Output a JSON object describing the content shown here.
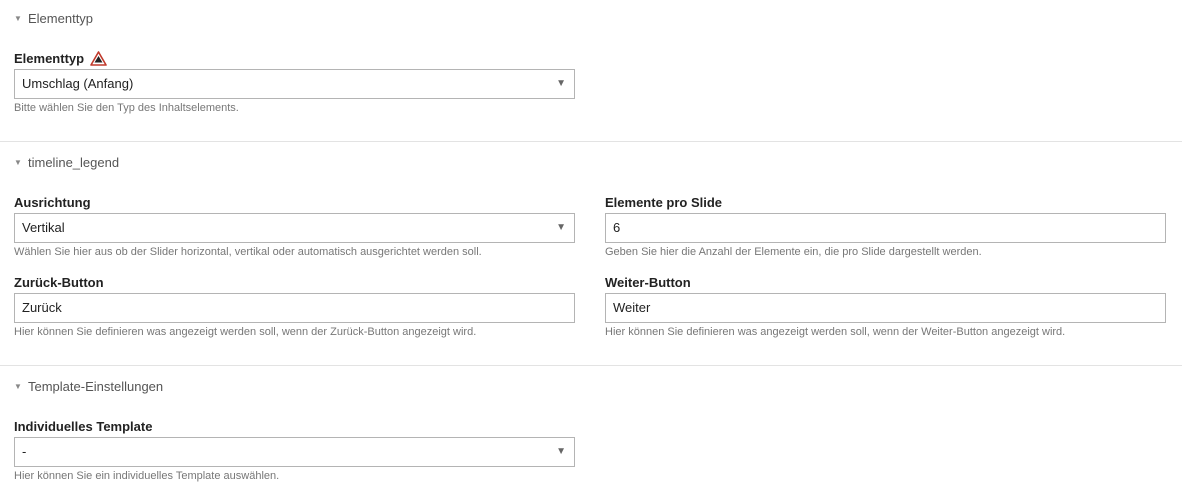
{
  "sections": {
    "elementtyp": {
      "legend": "Elementtyp"
    },
    "timeline": {
      "legend": "timeline_legend"
    },
    "template": {
      "legend": "Template-Einstellungen"
    }
  },
  "fields": {
    "elementtyp": {
      "label": "Elementtyp",
      "value": "Umschlag (Anfang)",
      "help": "Bitte wählen Sie den Typ des Inhaltselements.",
      "warning_icon": "warning-triangle-icon"
    },
    "ausrichtung": {
      "label": "Ausrichtung",
      "value": "Vertikal",
      "help": "Wählen Sie hier aus ob der Slider horizontal, vertikal oder automatisch ausgerichtet werden soll."
    },
    "elemente_pro_slide": {
      "label": "Elemente pro Slide",
      "value": "6",
      "help": "Geben Sie hier die Anzahl der Elemente ein, die pro Slide dargestellt werden."
    },
    "zurueck_button": {
      "label": "Zurück-Button",
      "value": "Zurück",
      "help": "Hier können Sie definieren was angezeigt werden soll, wenn der Zurück-Button angezeigt wird."
    },
    "weiter_button": {
      "label": "Weiter-Button",
      "value": "Weiter",
      "help": "Hier können Sie definieren was angezeigt werden soll, wenn der Weiter-Button angezeigt wird."
    },
    "individuelles_template": {
      "label": "Individuelles Template",
      "value": "-",
      "help": "Hier können Sie ein individuelles Template auswählen."
    }
  },
  "colors": {
    "warning": "#c0392b",
    "border": "#b4b4b4",
    "help_text": "#777777"
  }
}
